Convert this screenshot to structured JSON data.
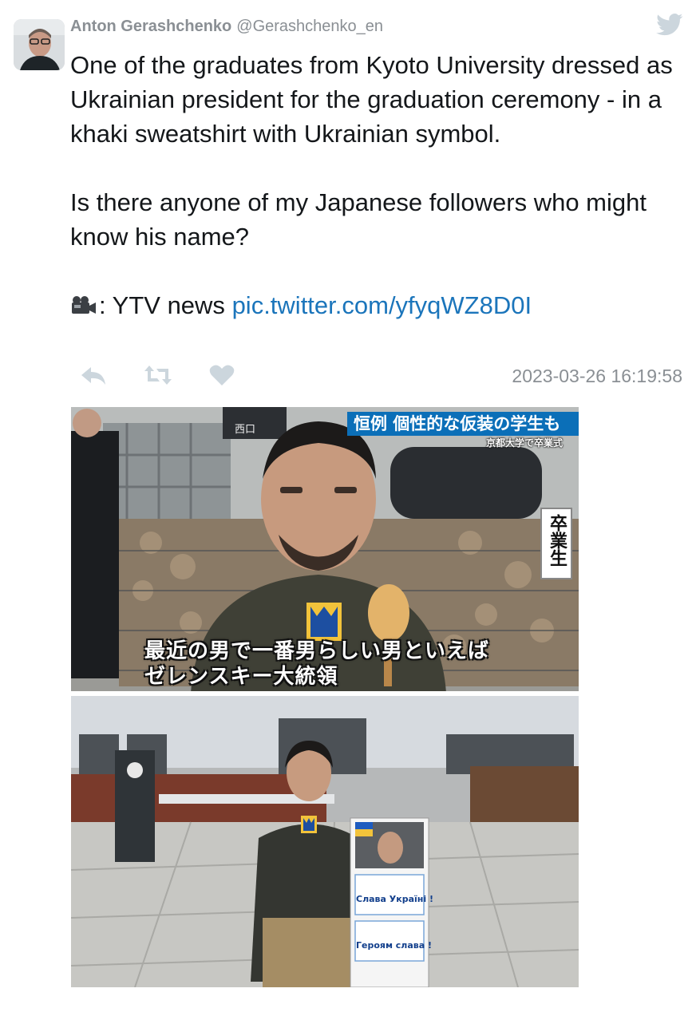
{
  "tweet": {
    "author_name": "Anton Gerashchenko",
    "author_handle": "@Gerashchenko_en",
    "paragraphs": [
      "One of the graduates from Kyoto University dressed as Ukrainian president for the graduation ceremony - in a khaki sweatshirt with Ukrainian symbol.",
      "Is there anyone of my Japanese followers who might know his name?"
    ],
    "credit_prefix": ": YTV news ",
    "link_text": "pic.twitter.com/yfyqWZ8D0I",
    "timestamp": "2023-03-26 16:19:58"
  },
  "icons": {
    "logo": "twitter-bird-icon",
    "camera": "video-camera-icon",
    "reply": "reply-icon",
    "retweet": "retweet-icon",
    "like": "heart-icon"
  },
  "colors": {
    "text": "#14171a",
    "muted": "#8a8f94",
    "link": "#1b75bb",
    "icon": "#ccd6dd",
    "tv_banner": "#0b6fb8"
  },
  "media": {
    "headline": "恒例 個性的な仮装の学生も",
    "subhead": "京都大学で卒業式",
    "vertical_label": "卒業生",
    "caption_line1": "最近の男で一番男らしい男といえば",
    "caption_line2": "ゼレンスキー大統領",
    "sign_line1": "Слава Україні !",
    "sign_line2": "Героям слава !"
  }
}
